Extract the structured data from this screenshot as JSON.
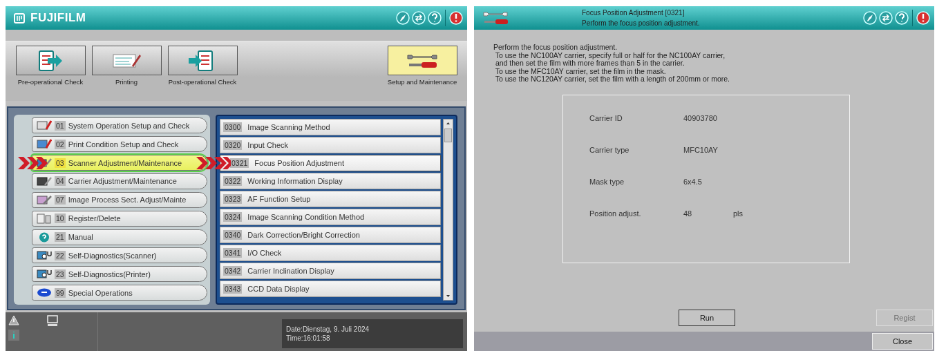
{
  "main_window": {
    "brand": "FUJIFILM",
    "toolbar": [
      {
        "label": "Pre-operational Check",
        "selected": false,
        "kind": "precheck"
      },
      {
        "label": "Printing",
        "selected": false,
        "kind": "printing"
      },
      {
        "label": "Post-operational Check",
        "selected": false,
        "kind": "postcheck"
      },
      {
        "label": "Setup and Maintenance",
        "selected": true,
        "kind": "setup"
      }
    ],
    "categories": [
      {
        "code": "01",
        "label": "System Operation Setup and Check",
        "selected": false
      },
      {
        "code": "02",
        "label": "Print Condition Setup and Check",
        "selected": false
      },
      {
        "code": "03",
        "label": "Scanner Adjustment/Maintenance",
        "selected": true
      },
      {
        "code": "04",
        "label": "Carrier Adjustment/Maintenance",
        "selected": false
      },
      {
        "code": "07",
        "label": "Image Process Sect. Adjust/Mainte",
        "selected": false
      },
      {
        "code": "10",
        "label": "Register/Delete",
        "selected": false
      },
      {
        "code": "21",
        "label": "Manual",
        "selected": false
      },
      {
        "code": "22",
        "label": "Self-Diagnostics(Scanner)",
        "selected": false
      },
      {
        "code": "23",
        "label": "Self-Diagnostics(Printer)",
        "selected": false
      },
      {
        "code": "99",
        "label": "Special Operations",
        "selected": false
      }
    ],
    "sub_items": [
      {
        "code": "0300",
        "label": "Image Scanning Method",
        "selected": false
      },
      {
        "code": "0320",
        "label": "Input Check",
        "selected": false
      },
      {
        "code": "0321",
        "label": "Focus Position Adjustment",
        "selected": true
      },
      {
        "code": "0322",
        "label": "Working Information Display",
        "selected": false
      },
      {
        "code": "0323",
        "label": "AF Function Setup",
        "selected": false
      },
      {
        "code": "0324",
        "label": "Image Scanning Condition Method",
        "selected": false
      },
      {
        "code": "0340",
        "label": "Dark Correction/Bright Correction",
        "selected": false
      },
      {
        "code": "0341",
        "label": "I/O Check",
        "selected": false
      },
      {
        "code": "0342",
        "label": "Carrier Inclination Display",
        "selected": false
      },
      {
        "code": "0343",
        "label": "CCD Data Display",
        "selected": false
      }
    ],
    "status_bar": {
      "date": "Date:Dienstag, 9. Juli 2024",
      "time": "Time:16:01:58"
    }
  },
  "dialog": {
    "title": "Focus Position Adjustment [0321]",
    "subtitle": "Perform the focus position adjustment.",
    "instructions": [
      "Perform the focus position adjustment.",
      " To use the NC100AY carrier, specify full or half for the NC100AY carrier,",
      " and then set the film with more frames than 5 in the carrier.",
      " To use the MFC10AY carrier, set the film in the mask.",
      " To use the NC120AY carrier, set the film with a length of 200mm or more."
    ],
    "fields": [
      {
        "label": "Carrier ID",
        "value": "40903780"
      },
      {
        "label": "Carrier type",
        "value": "MFC10AY"
      },
      {
        "label": "Mask type",
        "value": "6x4.5"
      },
      {
        "label": "Position adjust.",
        "value": "48",
        "unit": "pls"
      }
    ],
    "buttons": [
      {
        "label": "Run",
        "disabled": false
      },
      {
        "label": "Regist",
        "disabled": true
      }
    ],
    "footer_button": {
      "label": "Close",
      "disabled": false
    }
  }
}
